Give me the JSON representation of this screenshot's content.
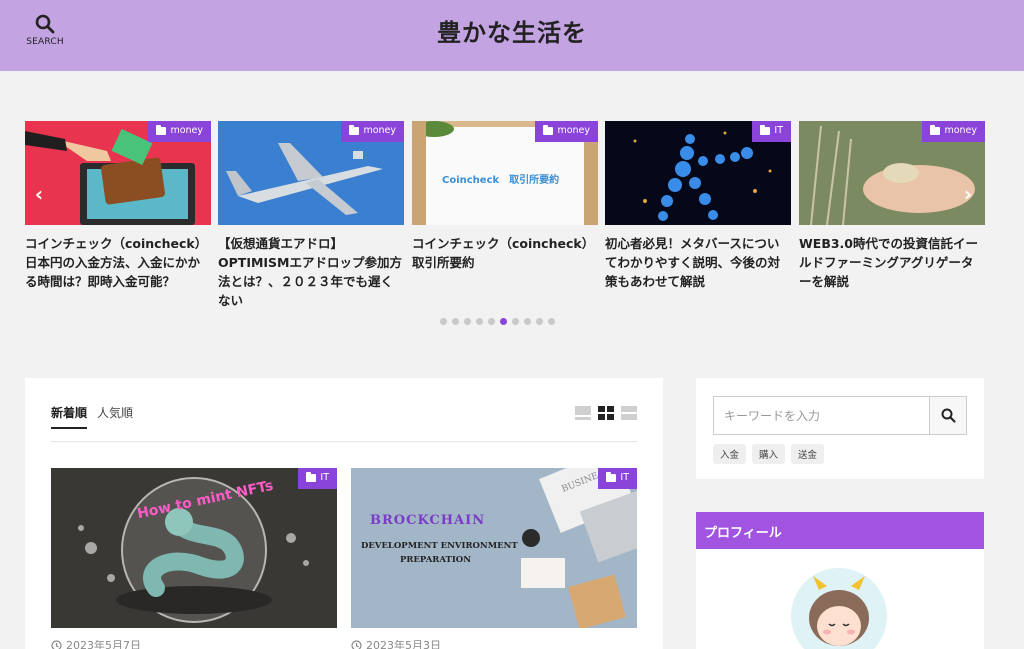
{
  "header": {
    "title": "豊かな生活を",
    "search_label": "SEARCH"
  },
  "slider": {
    "slides": [
      {
        "category": "money",
        "title": "コインチェック（coincheck）日本円の入金方法、入金にかかる時間は？即時入金可能？"
      },
      {
        "category": "money",
        "title": "【仮想通貨エアドロ】OPTIMISMエアドロップ参加方法とは？、２０２３年でも遅くない"
      },
      {
        "category": "money",
        "title": "コインチェック（coincheck）取引所要約",
        "thumb_text": "Coincheck　取引所要約"
      },
      {
        "category": "IT",
        "title": "初心者必見！メタバースについてわかりやすく説明、今後の対策もあわせて解説"
      },
      {
        "category": "money",
        "title": "WEB3.0時代での投資信託イールドファーミングアグリゲーターを解説"
      }
    ],
    "prev_arrow": "‹",
    "next_arrow": "›",
    "dot_count": 10,
    "active_dot": 5
  },
  "main": {
    "tabs": [
      {
        "label": "新着順",
        "active": true
      },
      {
        "label": "人気順",
        "active": false
      }
    ],
    "posts": [
      {
        "category": "IT",
        "date": "2023年5月7日",
        "thumb_text": "How to mint NFTs"
      },
      {
        "category": "IT",
        "date": "2023年5月3日",
        "thumb_line1": "BROCKCHAIN",
        "thumb_line2": "DEVELOPMENT ENVIRONMENT",
        "thumb_line3": "PREPARATION",
        "thumb_paper": "BUSINE"
      }
    ]
  },
  "sidebar": {
    "search_placeholder": "キーワードを入力",
    "tags": [
      "入金",
      "購入",
      "送金"
    ],
    "profile_title": "プロフィール"
  },
  "colors": {
    "header_bg": "#c3a3e2",
    "accent": "#8b44d9",
    "profile_header": "#a054e0"
  }
}
